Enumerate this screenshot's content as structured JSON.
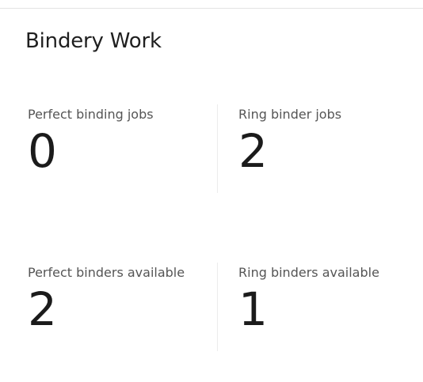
{
  "card": {
    "title": "Bindery Work"
  },
  "metrics": [
    {
      "label": "Perfect binding jobs",
      "value": "0"
    },
    {
      "label": "Ring binder jobs",
      "value": "2"
    },
    {
      "label": "Perfect binders available",
      "value": "2"
    },
    {
      "label": "Ring binders available",
      "value": "1"
    }
  ]
}
